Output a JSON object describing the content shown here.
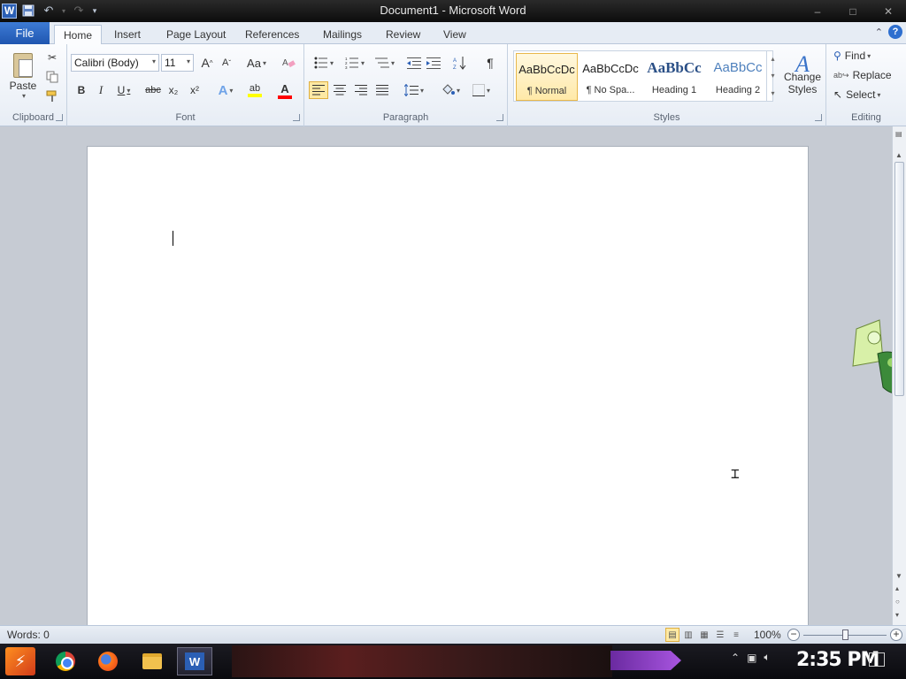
{
  "window": {
    "title": "Document1 - Microsoft Word",
    "logo": "W",
    "controls": {
      "minimize": "–",
      "maximize": "□",
      "close": "✕"
    }
  },
  "quick_access": {
    "save": "save-icon",
    "undo": "undo-icon",
    "redo": "redo-icon",
    "customize": "customize-icon"
  },
  "tabs": {
    "file": "File",
    "items": [
      "Home",
      "Insert",
      "Page Layout",
      "References",
      "Mailings",
      "Review",
      "View"
    ],
    "active": "Home"
  },
  "ribbon": {
    "clipboard": {
      "label": "Clipboard",
      "paste": "Paste"
    },
    "font": {
      "label": "Font",
      "family": "Calibri (Body)",
      "size": "11",
      "grow": "A",
      "shrink": "A",
      "change_case": "Aa",
      "bold": "B",
      "italic": "I",
      "underline": "U",
      "strikethrough": "abc",
      "subscript": "x₂",
      "superscript": "x²",
      "text_effects": "A",
      "highlight": "ab",
      "font_color": "A",
      "highlight_color": "#ffff00",
      "font_color_value": "#ff0000"
    },
    "paragraph": {
      "label": "Paragraph",
      "show_marks": "¶"
    },
    "styles": {
      "label": "Styles",
      "items": [
        {
          "sample": "AaBbCcDc",
          "name": "¶ Normal",
          "selected": true
        },
        {
          "sample": "AaBbCcDc",
          "name": "¶ No Spa...",
          "selected": false
        },
        {
          "sample": "AaBbCc",
          "name": "Heading 1",
          "selected": false
        },
        {
          "sample": "AaBbCc",
          "name": "Heading 2",
          "selected": false
        }
      ],
      "change_styles": "Change Styles"
    },
    "editing": {
      "label": "Editing",
      "find": "Find",
      "replace": "Replace",
      "select": "Select"
    }
  },
  "status": {
    "words": "Words: 0",
    "zoom": "100%",
    "zoom_level": 1.0
  },
  "taskbar": {
    "clock": "2:35 PM",
    "apps": [
      "chrome-icon",
      "firefox-icon",
      "folder-icon",
      "word-icon"
    ]
  }
}
